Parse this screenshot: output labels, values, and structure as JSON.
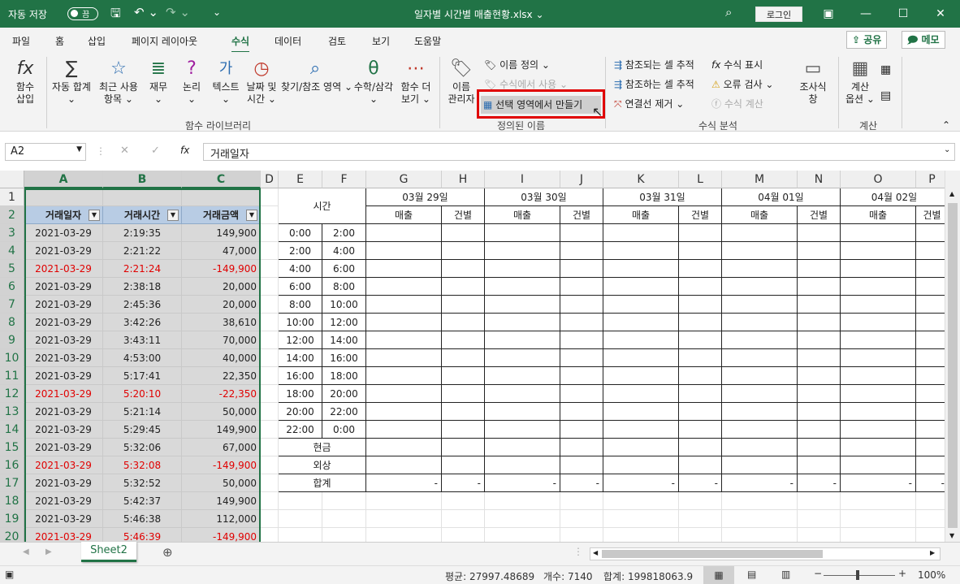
{
  "title_bar": {
    "autosave_label": "자동 저장",
    "autosave_state": "끔",
    "file_name": "일자별 시간별 매출현황.xlsx",
    "login_label": "로그인"
  },
  "menu": {
    "tabs": [
      "파일",
      "홈",
      "삽입",
      "페이지 레이아웃",
      "수식",
      "데이터",
      "검토",
      "보기",
      "도움말"
    ],
    "active_tab": "수식",
    "share_label": "공유",
    "memo_label": "메모"
  },
  "ribbon": {
    "function_library": {
      "group_label": "함수 라이브러리",
      "buttons": [
        {
          "icon": "fx",
          "label1": "함수",
          "label2": "삽입"
        },
        {
          "icon": "∑",
          "label1": "자동 합계",
          "label2": "⌄"
        },
        {
          "icon": "☆",
          "label1": "최근 사용",
          "label2": "항목 ⌄"
        },
        {
          "icon": "≣",
          "label1": "재무",
          "label2": "⌄"
        },
        {
          "icon": "?",
          "label1": "논리",
          "label2": "⌄"
        },
        {
          "icon": "가",
          "label1": "텍스트",
          "label2": "⌄"
        },
        {
          "icon": "◷",
          "label1": "날짜 및",
          "label2": "시간 ⌄"
        },
        {
          "icon": "⌕",
          "label1": "찾기/참조",
          "label2": "영역 ⌄"
        },
        {
          "icon": "θ",
          "label1": "수학/삼각",
          "label2": "⌄"
        },
        {
          "icon": "⋯",
          "label1": "함수 더",
          "label2": "보기 ⌄"
        }
      ]
    },
    "defined_names": {
      "group_label": "정의된 이름",
      "name_manager": {
        "label1": "이름",
        "label2": "관리자"
      },
      "define_name": "이름 정의",
      "use_in_formula": "수식에서 사용",
      "create_from_selection": "선택 영역에서 만들기"
    },
    "formula_auditing": {
      "group_label": "수식 분석",
      "trace_precedents": "참조되는 셀 추적",
      "trace_dependents": "참조하는 셀 추적",
      "remove_arrows": "연결선 제거",
      "show_formulas": "수식 표시",
      "error_checking": "오류 검사",
      "evaluate_formula": "수식 계산",
      "watch_window": {
        "label1": "조사식",
        "label2": "창"
      }
    },
    "calculation": {
      "group_label": "계산",
      "calc_options": {
        "label1": "계산",
        "label2": "옵션 ⌄"
      }
    }
  },
  "formula_bar": {
    "name_box": "A2",
    "content": "거래일자"
  },
  "columns": [
    "A",
    "B",
    "C",
    "D",
    "E",
    "F",
    "G",
    "H",
    "I",
    "J",
    "K",
    "L",
    "M",
    "N",
    "O",
    "P"
  ],
  "rows": [
    "1",
    "2",
    "3",
    "4",
    "5",
    "6",
    "7",
    "8",
    "9",
    "10",
    "11",
    "12",
    "13",
    "14",
    "15",
    "16",
    "17",
    "18",
    "19",
    "20"
  ],
  "data_table": {
    "headers": [
      "거래일자",
      "거래시간",
      "거래금액"
    ],
    "rows": [
      {
        "date": "2021-03-29",
        "time": "2:19:35",
        "amount": "149,900",
        "negative": false
      },
      {
        "date": "2021-03-29",
        "time": "2:21:22",
        "amount": "47,000",
        "negative": false
      },
      {
        "date": "2021-03-29",
        "time": "2:21:24",
        "amount": "-149,900",
        "negative": true
      },
      {
        "date": "2021-03-29",
        "time": "2:38:18",
        "amount": "20,000",
        "negative": false
      },
      {
        "date": "2021-03-29",
        "time": "2:45:36",
        "amount": "20,000",
        "negative": false
      },
      {
        "date": "2021-03-29",
        "time": "3:42:26",
        "amount": "38,610",
        "negative": false
      },
      {
        "date": "2021-03-29",
        "time": "3:43:11",
        "amount": "70,000",
        "negative": false
      },
      {
        "date": "2021-03-29",
        "time": "4:53:00",
        "amount": "40,000",
        "negative": false
      },
      {
        "date": "2021-03-29",
        "time": "5:17:41",
        "amount": "22,350",
        "negative": false
      },
      {
        "date": "2021-03-29",
        "time": "5:20:10",
        "amount": "-22,350",
        "negative": true
      },
      {
        "date": "2021-03-29",
        "time": "5:21:14",
        "amount": "50,000",
        "negative": false
      },
      {
        "date": "2021-03-29",
        "time": "5:29:45",
        "amount": "149,900",
        "negative": false
      },
      {
        "date": "2021-03-29",
        "time": "5:32:06",
        "amount": "67,000",
        "negative": false
      },
      {
        "date": "2021-03-29",
        "time": "5:32:08",
        "amount": "-149,900",
        "negative": true
      },
      {
        "date": "2021-03-29",
        "time": "5:32:52",
        "amount": "50,000",
        "negative": false
      },
      {
        "date": "2021-03-29",
        "time": "5:42:37",
        "amount": "149,900",
        "negative": false
      },
      {
        "date": "2021-03-29",
        "time": "5:46:38",
        "amount": "112,000",
        "negative": false
      },
      {
        "date": "2021-03-29",
        "time": "5:46:39",
        "amount": "-149,900",
        "negative": true
      }
    ]
  },
  "summary_table": {
    "time_header": "시간",
    "dates": [
      "03월 29일",
      "03월 30일",
      "03월 31일",
      "04월 01일",
      "04월 02일"
    ],
    "sales_label": "매출",
    "count_label": "건별",
    "time_slots": [
      [
        "0:00",
        "2:00"
      ],
      [
        "2:00",
        "4:00"
      ],
      [
        "4:00",
        "6:00"
      ],
      [
        "6:00",
        "8:00"
      ],
      [
        "8:00",
        "10:00"
      ],
      [
        "10:00",
        "12:00"
      ],
      [
        "12:00",
        "14:00"
      ],
      [
        "14:00",
        "16:00"
      ],
      [
        "16:00",
        "18:00"
      ],
      [
        "18:00",
        "20:00"
      ],
      [
        "20:00",
        "22:00"
      ],
      [
        "22:00",
        "0:00"
      ]
    ],
    "extra_rows": [
      "현금",
      "외상",
      "합계"
    ],
    "total_dash": "-"
  },
  "sheet_tabs": [
    "Sheet2"
  ],
  "status_bar": {
    "average": "평균: 27997.48689",
    "count": "개수: 7140",
    "sum": "합계: 199818063.9",
    "zoom": "100%"
  }
}
